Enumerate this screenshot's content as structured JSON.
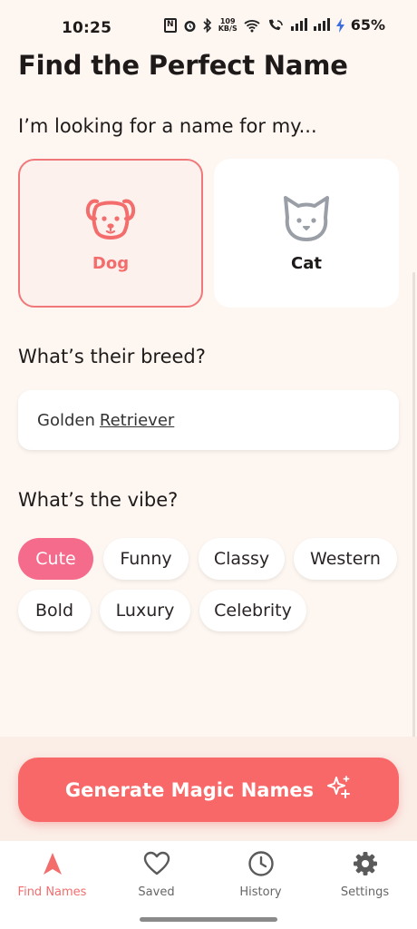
{
  "status_bar": {
    "time": "10:25",
    "speed_top": "109",
    "speed_bottom": "KB/S",
    "battery": "65%"
  },
  "page": {
    "title": "Find the Perfect Name",
    "pet_question": "I’m looking for a name for my...",
    "breed_question": "What’s their breed?",
    "vibe_question": "What’s the vibe?"
  },
  "pets": [
    {
      "label": "Dog",
      "selected": true,
      "icon": "dog-icon"
    },
    {
      "label": "Cat",
      "selected": false,
      "icon": "cat-icon"
    }
  ],
  "breed": {
    "word1": "Golden",
    "word2": "Retriever"
  },
  "vibes": [
    {
      "label": "Cute",
      "active": true
    },
    {
      "label": "Funny",
      "active": false
    },
    {
      "label": "Classy",
      "active": false
    },
    {
      "label": "Western",
      "active": false
    },
    {
      "label": "Bold",
      "active": false
    },
    {
      "label": "Luxury",
      "active": false
    },
    {
      "label": "Celebrity",
      "active": false
    }
  ],
  "generate": {
    "label": "Generate Magic Names",
    "icon": "sparkles-icon"
  },
  "nav": [
    {
      "label": "Find Names",
      "icon": "navigation-arrow-icon",
      "active": true
    },
    {
      "label": "Saved",
      "icon": "heart-icon",
      "active": false
    },
    {
      "label": "History",
      "icon": "clock-icon",
      "active": false
    },
    {
      "label": "Settings",
      "icon": "gear-icon",
      "active": false
    }
  ],
  "colors": {
    "accent": "#f86868",
    "chip_active": "#f56b8c",
    "background": "#fdf6f1"
  }
}
